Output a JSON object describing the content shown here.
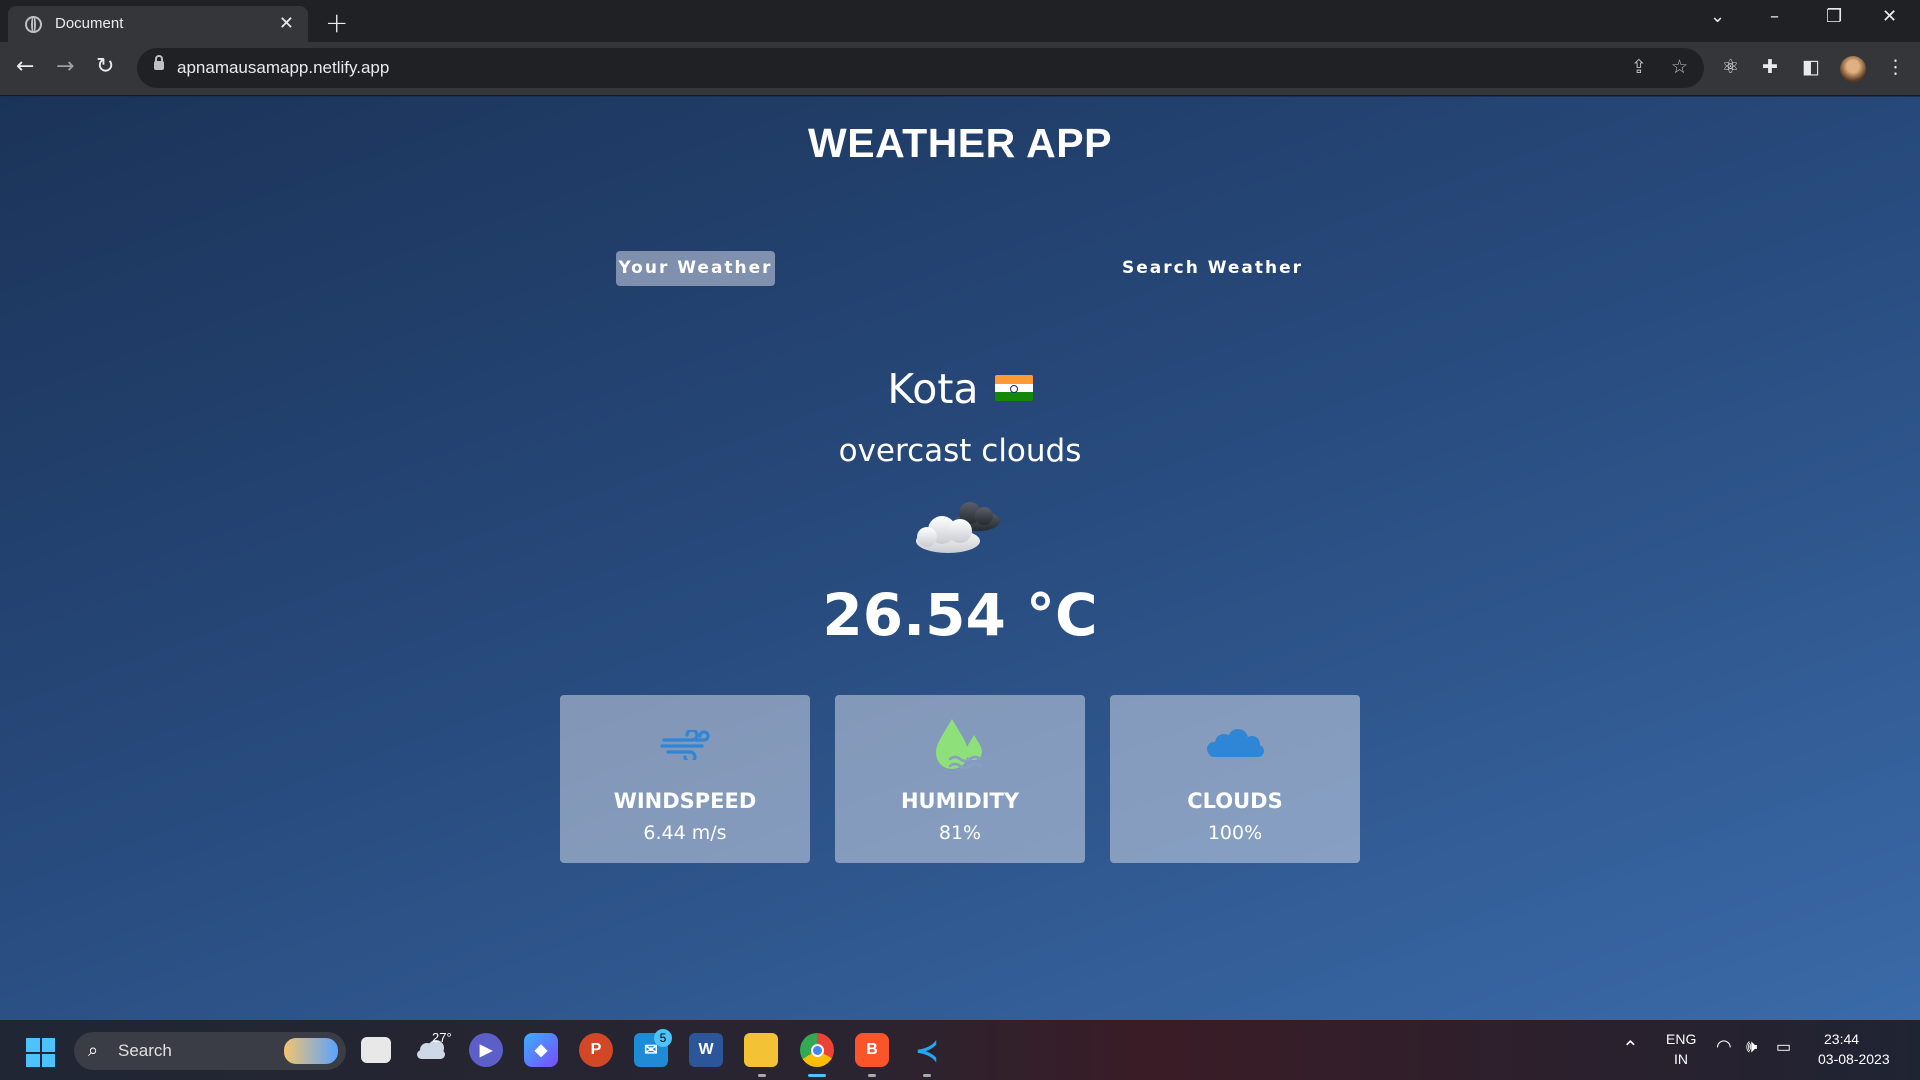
{
  "browser": {
    "tab_title": "Document",
    "tab_close": "✕",
    "new_tab": "+",
    "url": "apnamausamapp.netlify.app",
    "window_controls": [
      "⌄",
      "–",
      "❐",
      "✕"
    ]
  },
  "app": {
    "title": "WEATHER APP",
    "tabs": [
      {
        "label": "Your Weather",
        "active": true
      },
      {
        "label": "Search Weather",
        "active": false
      }
    ],
    "city": "Kota",
    "country_flag": "IN",
    "description": "overcast clouds",
    "weather_icon": "overcast-clouds-icon",
    "temperature": "26.54 °C",
    "stats": [
      {
        "icon": "wind-icon",
        "label": "WINDSPEED",
        "value": "6.44 m/s"
      },
      {
        "icon": "humidity-icon",
        "label": "HUMIDITY",
        "value": "81%"
      },
      {
        "icon": "cloud-icon",
        "label": "CLOUDS",
        "value": "100%"
      }
    ]
  },
  "taskbar": {
    "search_label": "Search",
    "weather_temp": "27°",
    "mail_badge": "5",
    "language": "ENG",
    "region": "IN",
    "time": "23:44",
    "date": "03-08-2023"
  },
  "colors": {
    "page_top": "#1b3358",
    "page_bottom": "#3a6aa8",
    "card_bg": "rgba(219,226,239,0.5)",
    "wind_icon": "#2f86d6",
    "humidity_icon": "#8ee07a",
    "cloud_icon": "#2f86d6"
  }
}
